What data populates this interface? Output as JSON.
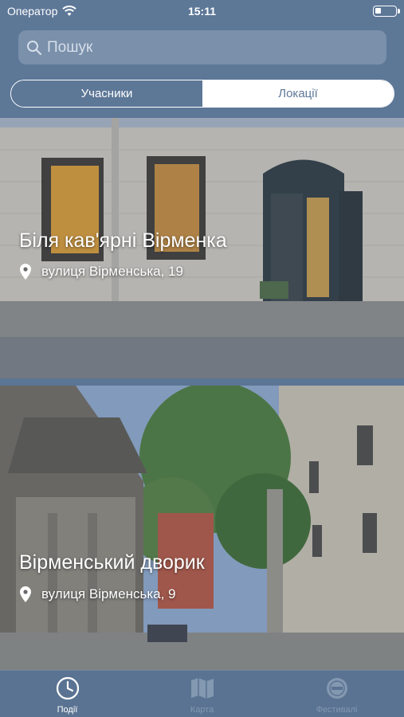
{
  "status_bar": {
    "carrier": "Оператор",
    "time": "15:11",
    "battery_level": 0.3
  },
  "search": {
    "placeholder": "Пошук",
    "value": ""
  },
  "segments": [
    {
      "label": "Учасники",
      "selected": true
    },
    {
      "label": "Локації",
      "selected": false
    }
  ],
  "locations": [
    {
      "title": "Біля кав'ярні Вірменка",
      "address": "вулиця Вірменська, 19"
    },
    {
      "title": "Вірменський дворик",
      "address": "вулиця Вірменська, 9"
    }
  ],
  "tabbar": {
    "items": [
      {
        "label": "Події",
        "icon": "clock-icon",
        "active": true
      },
      {
        "label": "Карта",
        "icon": "map-icon",
        "active": false
      },
      {
        "label": "Фестивалі",
        "icon": "festival-icon",
        "active": false
      }
    ]
  },
  "colors": {
    "header": "#5d7797",
    "search_bg": "#7a90ab",
    "tab_inactive": "#8398b1"
  }
}
